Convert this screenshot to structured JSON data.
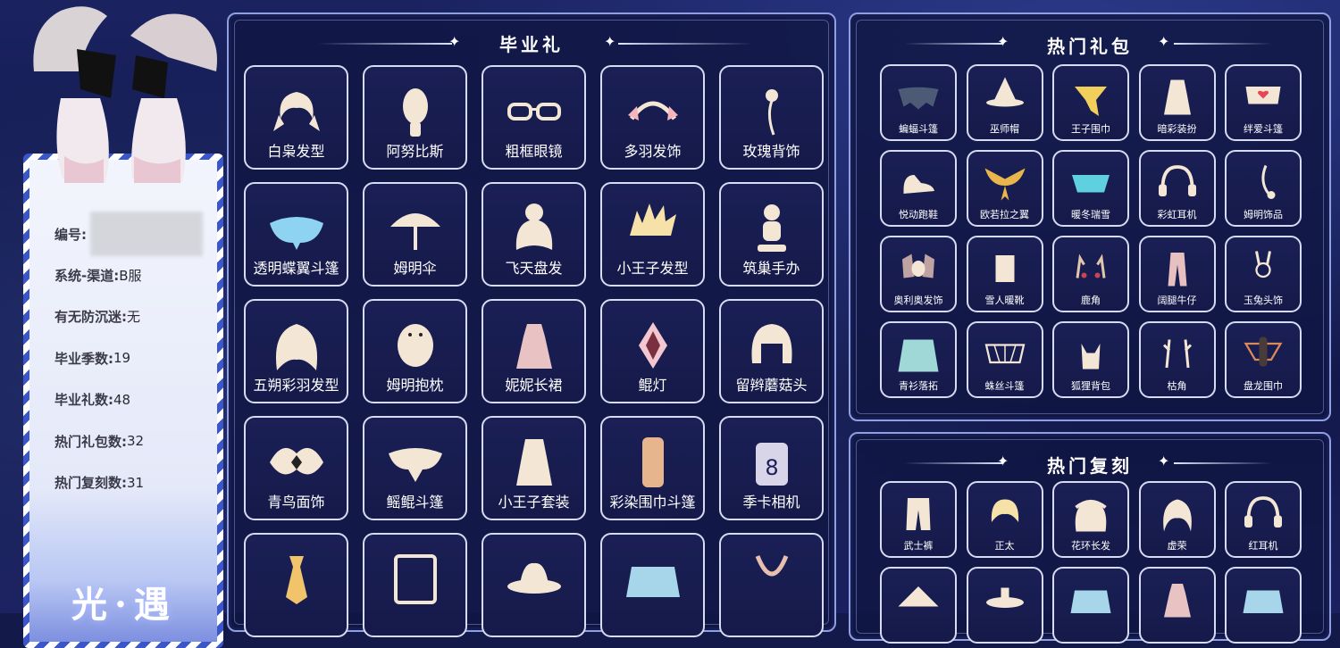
{
  "left_card": {
    "rows": [
      {
        "label": "编号:",
        "value": ""
      },
      {
        "label": "系统-渠道:",
        "value": "B服"
      },
      {
        "label": "有无防沉迷:",
        "value": "无"
      },
      {
        "label": "毕业季数:",
        "value": "19"
      },
      {
        "label": "毕业礼数:",
        "value": "48"
      },
      {
        "label": "热门礼包数:",
        "value": "32"
      },
      {
        "label": "热门复刻数:",
        "value": "31"
      }
    ],
    "logo": "光·遇"
  },
  "graduation": {
    "title": "毕业礼",
    "items": [
      {
        "label": "白枭发型",
        "icon": "hair-icon"
      },
      {
        "label": "阿努比斯",
        "icon": "mask-icon"
      },
      {
        "label": "粗框眼镜",
        "icon": "glasses-icon"
      },
      {
        "label": "多羽发饰",
        "icon": "headband-icon"
      },
      {
        "label": "玫瑰背饰",
        "icon": "rose-icon"
      },
      {
        "label": "透明蝶翼斗篷",
        "icon": "butterfly-cape-icon"
      },
      {
        "label": "姆明伞",
        "icon": "umbrella-icon"
      },
      {
        "label": "飞天盘发",
        "icon": "hair-bun-icon"
      },
      {
        "label": "小王子发型",
        "icon": "spiky-hair-icon"
      },
      {
        "label": "筑巢手办",
        "icon": "figurine-icon"
      },
      {
        "label": "五朔彩羽发型",
        "icon": "long-hair-icon"
      },
      {
        "label": "姆明抱枕",
        "icon": "moomin-pillow-icon"
      },
      {
        "label": "妮妮长裙",
        "icon": "dress-icon"
      },
      {
        "label": "鲲灯",
        "icon": "lantern-icon"
      },
      {
        "label": "留辫蘑菇头",
        "icon": "bob-hair-icon"
      },
      {
        "label": "青鸟面饰",
        "icon": "bird-mask-icon"
      },
      {
        "label": "鳐鲲斗篷",
        "icon": "manta-cape-icon"
      },
      {
        "label": "小王子套装",
        "icon": "outfit-icon"
      },
      {
        "label": "彩染围巾斗篷",
        "icon": "scarf-cape-icon"
      },
      {
        "label": "季卡相机",
        "icon": "camera-icon"
      },
      {
        "label": "",
        "icon": "tie-icon"
      },
      {
        "label": "",
        "icon": "piano-icon"
      },
      {
        "label": "",
        "icon": "hat-icon"
      },
      {
        "label": "",
        "icon": "cape-icon"
      },
      {
        "label": "",
        "icon": "necklace-icon"
      }
    ]
  },
  "hot_packs": {
    "title": "热门礼包",
    "items": [
      {
        "label": "蝙蝠斗篷",
        "icon": "bat-cape-icon"
      },
      {
        "label": "巫师帽",
        "icon": "witch-hat-icon"
      },
      {
        "label": "王子围巾",
        "icon": "scarf-icon"
      },
      {
        "label": "暗彩装扮",
        "icon": "outfit-icon"
      },
      {
        "label": "绊爱斗篷",
        "icon": "heart-cape-icon"
      },
      {
        "label": "悦动跑鞋",
        "icon": "shoe-icon"
      },
      {
        "label": "欧若拉之翼",
        "icon": "wings-icon"
      },
      {
        "label": "暖冬瑞雪",
        "icon": "snow-cape-icon"
      },
      {
        "label": "彩虹耳机",
        "icon": "headphones-icon"
      },
      {
        "label": "姆明饰品",
        "icon": "tail-icon"
      },
      {
        "label": "奥利奥发饰",
        "icon": "dog-ears-icon"
      },
      {
        "label": "雪人暖靴",
        "icon": "boots-icon"
      },
      {
        "label": "鹿角",
        "icon": "antlers-icon"
      },
      {
        "label": "阔腿牛仔",
        "icon": "jeans-icon"
      },
      {
        "label": "玉兔头饰",
        "icon": "rabbit-icon"
      },
      {
        "label": "青衫落拓",
        "icon": "robe-icon"
      },
      {
        "label": "蛛丝斗篷",
        "icon": "web-cape-icon"
      },
      {
        "label": "狐狸背包",
        "icon": "fox-icon"
      },
      {
        "label": "枯角",
        "icon": "branch-horns-icon"
      },
      {
        "label": "盘龙围巾",
        "icon": "dragon-scarf-icon"
      }
    ]
  },
  "hot_reruns": {
    "title": "热门复刻",
    "items": [
      {
        "label": "武士裤",
        "icon": "pants-icon"
      },
      {
        "label": "正太",
        "icon": "short-hair-icon"
      },
      {
        "label": "花环长发",
        "icon": "wreath-hair-icon"
      },
      {
        "label": "虚荣",
        "icon": "wavy-hair-icon"
      },
      {
        "label": "红耳机",
        "icon": "headphones-icon"
      },
      {
        "label": "",
        "icon": "straw-hat-icon"
      },
      {
        "label": "",
        "icon": "lamp-icon"
      },
      {
        "label": "",
        "icon": "cape-icon"
      },
      {
        "label": "",
        "icon": "dress-icon"
      },
      {
        "label": "",
        "icon": "cape-icon"
      }
    ]
  }
}
